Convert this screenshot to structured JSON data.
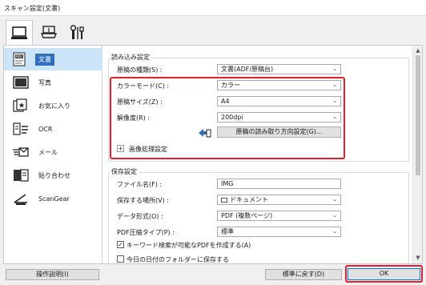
{
  "window": {
    "title": "スキャン設定(文書)"
  },
  "top_tabs": [
    {
      "icon": "scan-from-computer-icon"
    },
    {
      "icon": "scan-from-panel-icon"
    },
    {
      "icon": "general-settings-tools-icon"
    }
  ],
  "sidebar": {
    "items": [
      {
        "icon": "document-icon",
        "label": "文書"
      },
      {
        "icon": "photo-icon",
        "label": "写真"
      },
      {
        "icon": "favorites-icon",
        "label": "お気に入り"
      },
      {
        "icon": "ocr-icon",
        "label": "OCR"
      },
      {
        "icon": "mail-icon",
        "label": "メール"
      },
      {
        "icon": "stitch-icon",
        "label": "貼り合わせ"
      },
      {
        "icon": "scangear-icon",
        "label": "ScanGear"
      }
    ]
  },
  "scan_options": {
    "title": "読み込み設定",
    "source_label": "原稿の種類(S) :",
    "source_value": "文書(ADF/原稿台)",
    "color_mode_label": "カラーモード(C) :",
    "color_mode_value": "カラー",
    "paper_size_label": "原稿サイズ(Z) :",
    "paper_size_value": "A4",
    "resolution_label": "解像度(R) :",
    "resolution_value": "200dpi",
    "orientation_button": "原稿の読み取り方向設定(G)...",
    "image_processing_label": "画像処理設定"
  },
  "save_settings": {
    "title": "保存設定",
    "filename_label": "ファイル名(F) :",
    "filename_value": "IMG",
    "save_in_label": "保存する場所(V) :",
    "save_in_value": "ドキュメント",
    "data_format_label": "データ形式(O) :",
    "data_format_value": "PDF (複数ページ)",
    "pdf_compression_label": "PDF圧縮タイプ(P) :",
    "pdf_compression_value": "標準",
    "keyword_search_label": "キーワード検索が可能なPDFを作成する(A)",
    "keyword_search_checked": true,
    "subfolder_label": "今日の日付のフォルダーに保存する",
    "subfolder_checked": false
  },
  "footer": {
    "instructions_button": "操作説明(I)",
    "defaults_button": "標準に戻す(D)",
    "ok_button": "OK"
  }
}
